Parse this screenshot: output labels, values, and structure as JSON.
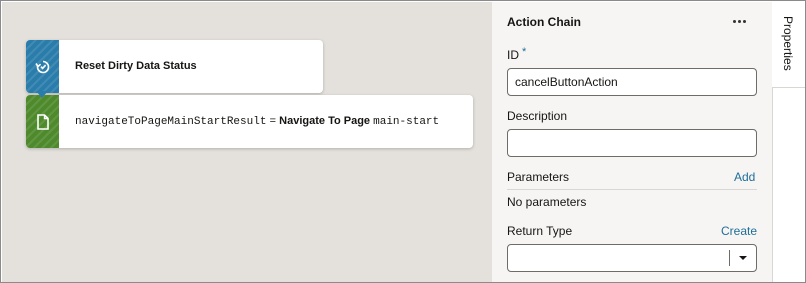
{
  "canvas": {
    "nodes": [
      {
        "label": "Reset Dirty Data Status",
        "icon": "reset-icon",
        "color": "#2a7dab"
      },
      {
        "variable": "navigateToPageMainStartResult",
        "operator": "=",
        "action": "Navigate To Page",
        "target": "main-start",
        "icon": "page-icon",
        "color": "#4e8a2c"
      }
    ]
  },
  "panel": {
    "title": "Action Chain",
    "id": {
      "label": "ID",
      "required_mark": "*",
      "value": "cancelButtonAction"
    },
    "description": {
      "label": "Description",
      "value": ""
    },
    "parameters": {
      "label": "Parameters",
      "add_link": "Add",
      "empty_text": "No parameters"
    },
    "return_type": {
      "label": "Return Type",
      "create_link": "Create",
      "value": ""
    }
  },
  "rail": {
    "tab_label": "Properties"
  },
  "colors": {
    "accent": "#1f6e98",
    "canvas_bg": "#e4e1dc",
    "panel_bg": "#f6f5f3"
  }
}
